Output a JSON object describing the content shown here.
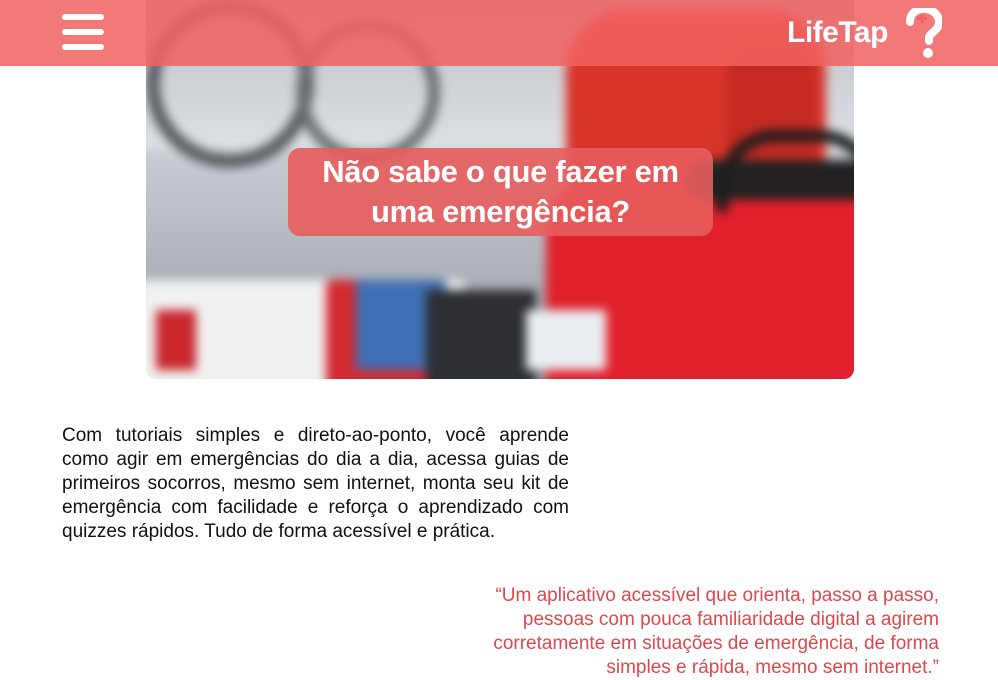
{
  "header": {
    "menu_icon": "hamburger-menu-icon",
    "logo_text": "LifeTap",
    "logo_icon": "question-mark-plus-icon",
    "color": "#F16262"
  },
  "hero": {
    "image": "first-aid-kit-emergency-photo",
    "title": "Não sabe o que fazer em uma emergência?",
    "title_background": "#E85D5D"
  },
  "intro": {
    "text": "Com tutoriais simples e direto-ao-ponto, você aprende como agir em emergências do dia a dia, acessa guias de primeiros socorros, mesmo sem internet, monta seu kit de emergência com facilidade e reforça o aprendizado com quizzes rápidos. Tudo de forma acessível e prática."
  },
  "quote": {
    "text": "“Um aplicativo acessível que orienta, passo a passo, pessoas com pouca familiaridade digital a agirem corretamente em situações de emergência, de forma simples e rápida, mesmo sem internet.”",
    "color": "#E0474C"
  }
}
